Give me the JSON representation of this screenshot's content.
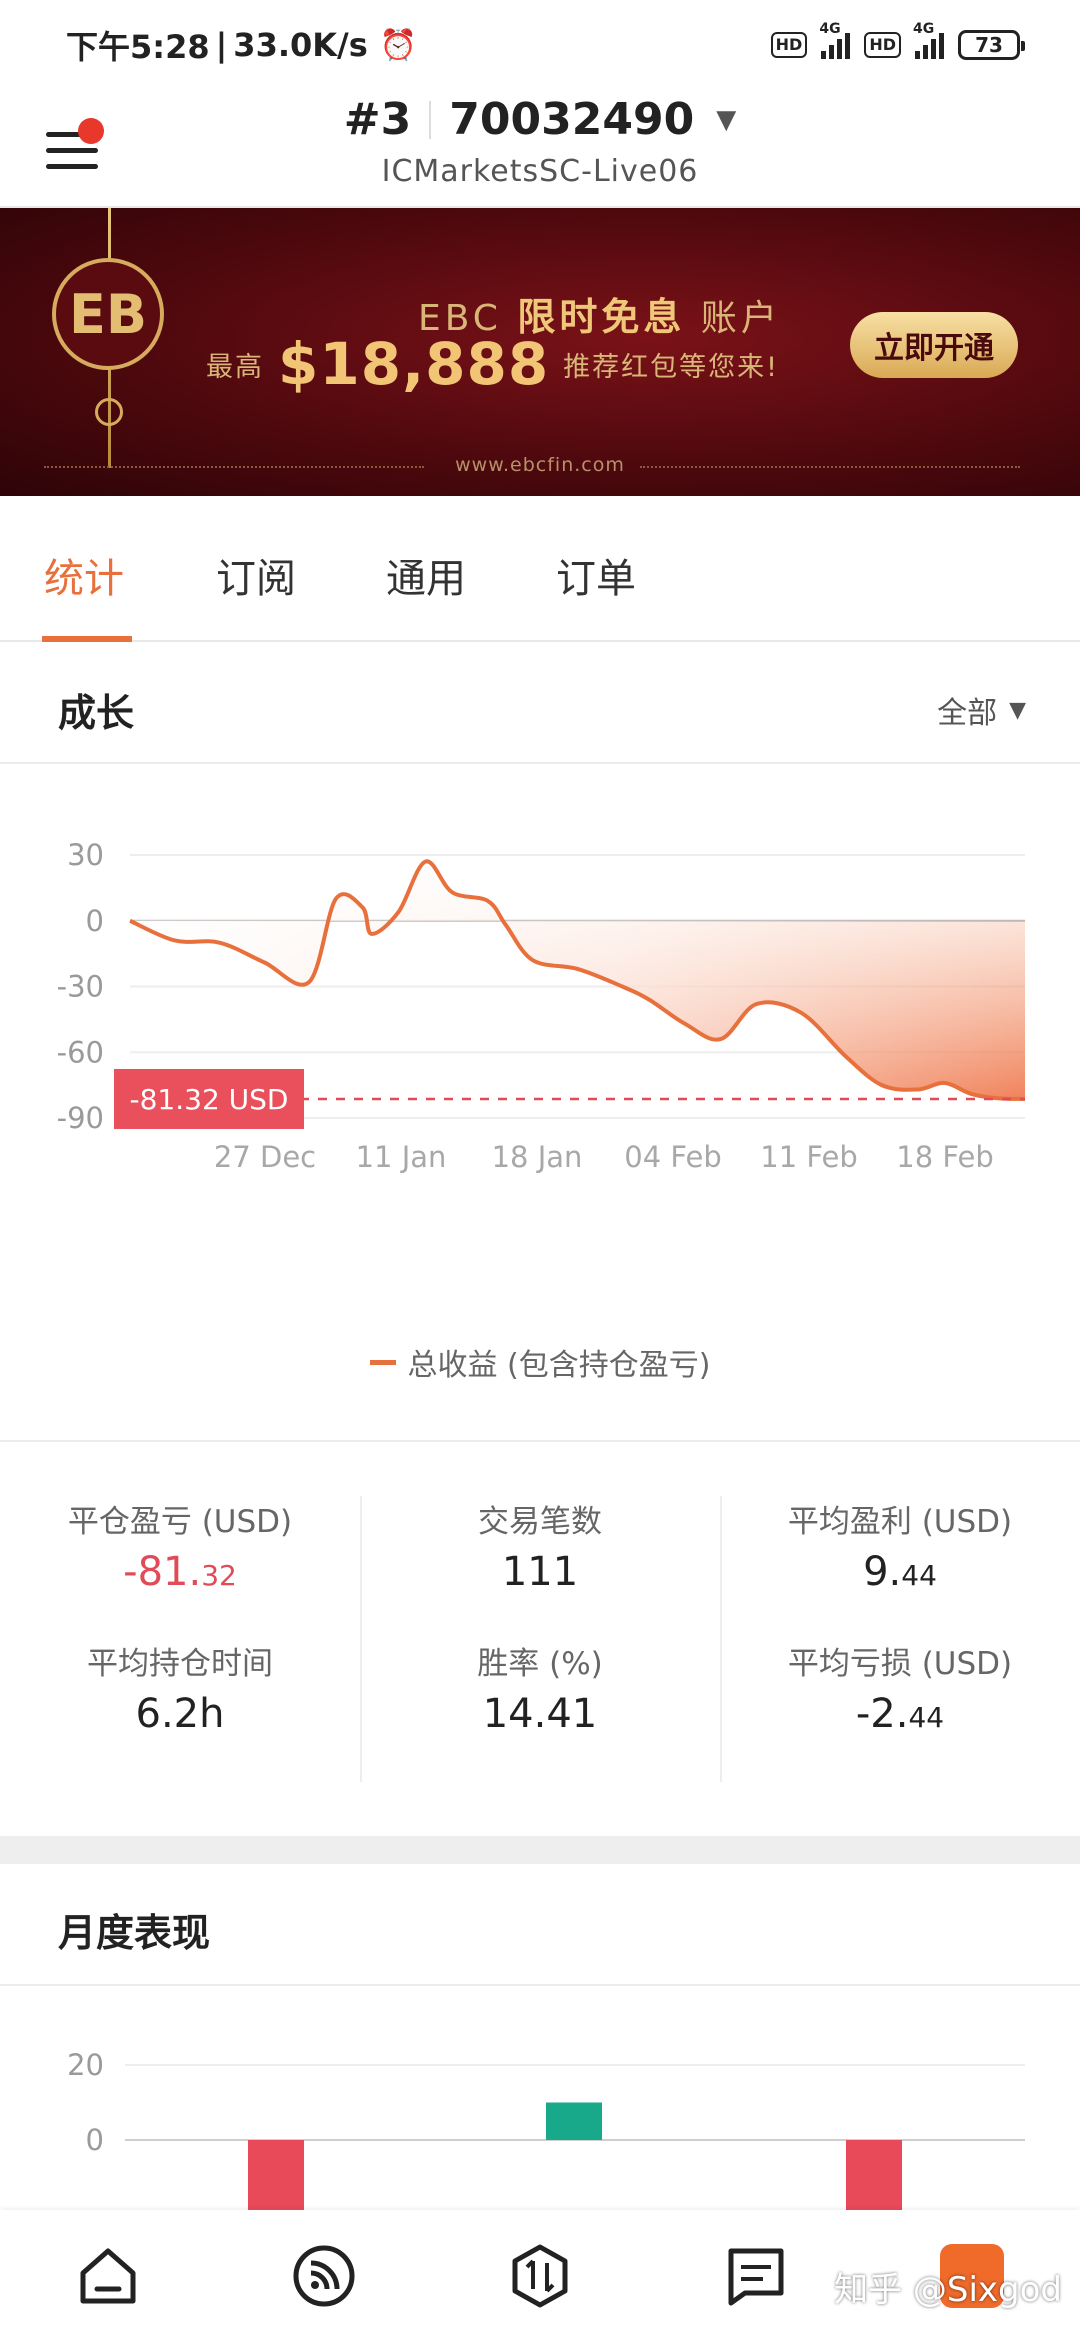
{
  "status_bar": {
    "time": "下午5:28",
    "speed": "33.0K/s",
    "hd1": "HD",
    "net1": "4G",
    "hd2": "HD",
    "net2": "4G",
    "battery": "73"
  },
  "header": {
    "account_index": "#3",
    "account_number": "70032490",
    "server": "ICMarketsSC-Live06"
  },
  "banner": {
    "logo_text": "EB",
    "headline_prefix": "EBC",
    "headline_bold": "限时免息",
    "headline_suffix": "账户",
    "sub_prefix": "最高",
    "amount": "$18,888",
    "sub_suffix": "推荐红包等您来!",
    "cta": "立即开通",
    "url": "www.ebcfin.com"
  },
  "tabs": [
    "统计",
    "订阅",
    "通用",
    "订单"
  ],
  "growth": {
    "title": "成长",
    "filter": "全部",
    "legend": "总收益 (包含持仓盈亏)"
  },
  "chart_data": [
    {
      "type": "area",
      "title": "成长",
      "y_ticks": [
        30,
        0,
        -30,
        -60,
        -90
      ],
      "ylim": [
        -90,
        30
      ],
      "x_ticks": [
        "27 Dec",
        "11 Jan",
        "18 Jan",
        "04 Feb",
        "11 Feb",
        "18 Feb"
      ],
      "current_value_label": "-81.32 USD",
      "current_value": -81.32,
      "series": [
        {
          "name": "总收益 (包含持仓盈亏)",
          "x_index": [
            0,
            5,
            10,
            15,
            20,
            23,
            26,
            27,
            30,
            33,
            36,
            40,
            42,
            45,
            50,
            55,
            58,
            62,
            66,
            70,
            75,
            80,
            84,
            88,
            91,
            94,
            97,
            100
          ],
          "y": [
            0,
            -9,
            -10,
            -19,
            -28,
            10,
            6,
            -6,
            4,
            27,
            13,
            9,
            -2,
            -18,
            -22,
            -30,
            -36,
            -47,
            -54,
            -38,
            -42,
            -62,
            -75,
            -77,
            -74,
            -79,
            -81,
            -81.32
          ]
        }
      ]
    },
    {
      "type": "bar",
      "title": "月度表现",
      "y_ticks": [
        20,
        0
      ],
      "categories": [
        "",
        "",
        ""
      ],
      "values": [
        -40,
        10,
        -40
      ],
      "colors": [
        "#e84a5a",
        "#18a98a",
        "#e84a5a"
      ]
    }
  ],
  "stats": [
    {
      "label": "平仓盈亏 (USD)",
      "main": "-81.",
      "minor": "32",
      "negative": true
    },
    {
      "label": "交易笔数",
      "main": "111",
      "minor": "",
      "negative": false
    },
    {
      "label": "平均盈利 (USD)",
      "main": "9.",
      "minor": "44",
      "negative": false
    },
    {
      "label": "平均持仓时间",
      "main": "6.2h",
      "minor": "",
      "negative": false
    },
    {
      "label": "胜率 (%)",
      "main": "14.41",
      "minor": "",
      "negative": false
    },
    {
      "label": "平均亏损 (USD)",
      "main": "-2.",
      "minor": "44",
      "negative": false
    }
  ],
  "monthly": {
    "title": "月度表现"
  },
  "bottom_nav": {
    "items": [
      "home-icon",
      "feed-icon",
      "trade-icon",
      "messages-icon",
      "profile-icon"
    ],
    "watermark": "知乎 @Sixgod"
  },
  "colors": {
    "accent": "#e8703c",
    "negative": "#e04b57",
    "positive_bar": "#18a98a"
  }
}
